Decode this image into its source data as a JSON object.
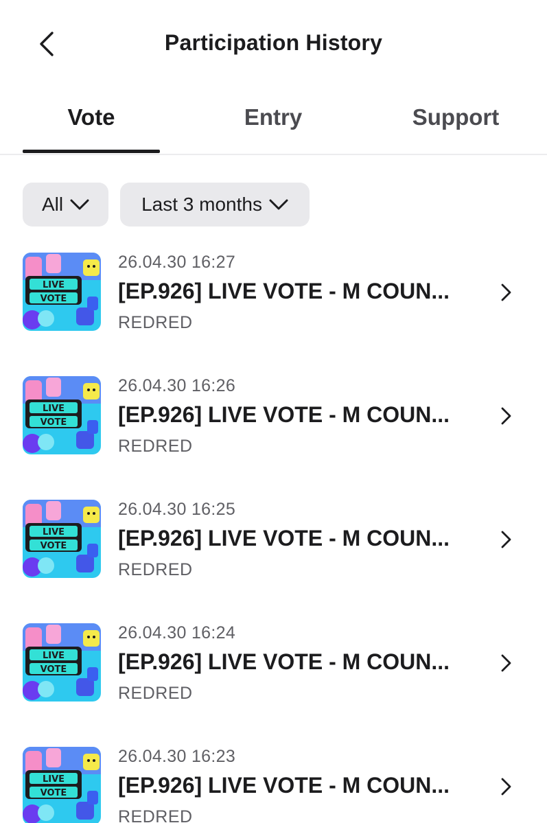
{
  "header": {
    "title": "Participation History",
    "back_icon": "chevron-left-icon"
  },
  "tabs": [
    {
      "label": "Vote",
      "active": true
    },
    {
      "label": "Entry",
      "active": false
    },
    {
      "label": "Support",
      "active": false
    }
  ],
  "filters": {
    "category": "All",
    "period": "Last 3 months"
  },
  "thumbnail": {
    "line1": "LIVE",
    "line2": "VOTE"
  },
  "history": [
    {
      "datetime": "26.04.30 16:27",
      "title": "[EP.926] LIVE VOTE - M COUN...",
      "subtitle": "REDRED"
    },
    {
      "datetime": "26.04.30 16:26",
      "title": "[EP.926] LIVE VOTE - M COUN...",
      "subtitle": "REDRED"
    },
    {
      "datetime": "26.04.30 16:25",
      "title": "[EP.926] LIVE VOTE - M COUN...",
      "subtitle": "REDRED"
    },
    {
      "datetime": "26.04.30 16:24",
      "title": "[EP.926] LIVE VOTE - M COUN...",
      "subtitle": "REDRED"
    },
    {
      "datetime": "26.04.30 16:23",
      "title": "[EP.926] LIVE VOTE - M COUN...",
      "subtitle": "REDRED"
    }
  ],
  "colors": {
    "text_primary": "#1c1c1e",
    "text_secondary": "#5f5f64",
    "filter_bg": "#e9e9ec",
    "thumb_bg": "#2ec9ef",
    "thumb_band": "#1c1c1e",
    "thumb_text": "#5cf0e6"
  }
}
